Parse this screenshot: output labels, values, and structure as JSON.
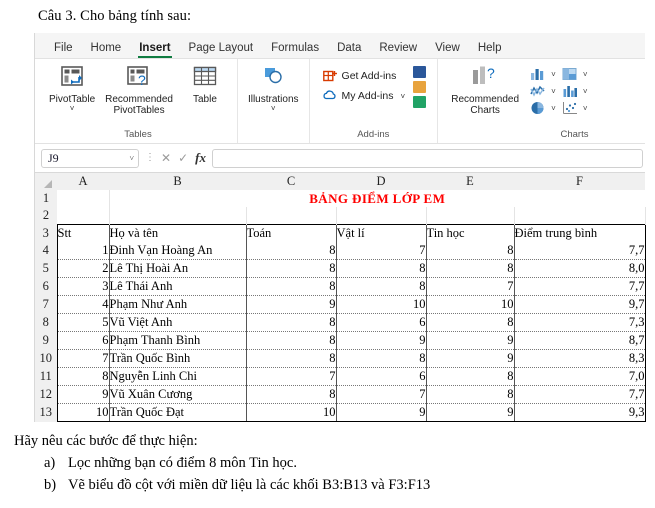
{
  "question": {
    "heading": "Câu 3. Cho bảng tính sau:"
  },
  "excel": {
    "ribbon_tabs": [
      {
        "label": "File",
        "active": false
      },
      {
        "label": "Home",
        "active": false
      },
      {
        "label": "Insert",
        "active": true
      },
      {
        "label": "Page Layout",
        "active": false
      },
      {
        "label": "Formulas",
        "active": false
      },
      {
        "label": "Data",
        "active": false
      },
      {
        "label": "Review",
        "active": false
      },
      {
        "label": "View",
        "active": false
      },
      {
        "label": "Help",
        "active": false
      }
    ],
    "groups": {
      "tables": {
        "label": "Tables",
        "buttons": [
          {
            "label": "PivotTable",
            "icon": "pivot-table-icon",
            "has_chevron": true
          },
          {
            "label": "Recommended\nPivotTables",
            "icon": "recommended-pivot-tables-icon",
            "has_chevron": false
          },
          {
            "label": "Table",
            "icon": "table-icon",
            "has_chevron": false
          }
        ]
      },
      "illustrations": {
        "label": "",
        "buttons": [
          {
            "label": "Illustrations",
            "icon": "illustrations-icon",
            "has_chevron": true
          }
        ]
      },
      "addins": {
        "label": "Add-ins",
        "buttons": [
          {
            "label": "Get Add-ins",
            "icon": "get-add-ins-icon",
            "has_chevron": false
          },
          {
            "label": "My Add-ins",
            "icon": "my-add-ins-icon",
            "has_chevron": true
          }
        ],
        "app_icons": [
          "visio-app-icon",
          "bing-maps-app-icon",
          "people-graph-app-icon"
        ]
      },
      "charts": {
        "label": "Charts",
        "recommended": {
          "label": "Recommended\nCharts",
          "icon": "recommended-charts-icon"
        },
        "mini_icons": [
          "column-chart-icon",
          "hierarchy-chart-icon",
          "line-chart-icon",
          "bar-chart-icon",
          "pie-chart-icon",
          "scatter-chart-icon"
        ]
      }
    },
    "formula_bar": {
      "name_box_value": "J9",
      "name_box_chevron": "chevron-down-icon",
      "cancel_icon": "cancel-icon",
      "enter_icon": "confirm-icon",
      "function_icon": "fx-icon",
      "formula_value": ""
    },
    "sheet": {
      "column_headers": [
        "A",
        "B",
        "C",
        "D",
        "E",
        "F"
      ],
      "row_headers": [
        "1",
        "2",
        "3",
        "4",
        "5",
        "6",
        "7",
        "8",
        "9",
        "10",
        "11",
        "12",
        "13"
      ],
      "title_row": {
        "row": "1",
        "text": "BẢNG ĐIỂM LỚP EM",
        "color": "#ff0000"
      },
      "header_row": {
        "row": "3",
        "cells": [
          "Stt",
          "Họ và tên",
          "Toán",
          "Vật lí",
          "Tin học",
          "Điểm trung bình"
        ]
      },
      "data_rows": [
        {
          "row": "4",
          "cells": [
            "1",
            "Đinh Vạn Hoàng An",
            "8",
            "7",
            "8",
            "7,7"
          ]
        },
        {
          "row": "5",
          "cells": [
            "2",
            "Lê Thị Hoài An",
            "8",
            "8",
            "8",
            "8,0"
          ]
        },
        {
          "row": "6",
          "cells": [
            "3",
            "Lê Thái Anh",
            "8",
            "8",
            "7",
            "7,7"
          ]
        },
        {
          "row": "7",
          "cells": [
            "4",
            "Phạm Như Anh",
            "9",
            "10",
            "10",
            "9,7"
          ]
        },
        {
          "row": "8",
          "cells": [
            "5",
            "Vũ Việt Anh",
            "8",
            "6",
            "8",
            "7,3"
          ]
        },
        {
          "row": "9",
          "cells": [
            "6",
            "Phạm Thanh Bình",
            "8",
            "9",
            "9",
            "8,7"
          ]
        },
        {
          "row": "10",
          "cells": [
            "7",
            "Trần Quốc Bình",
            "8",
            "8",
            "9",
            "8,3"
          ]
        },
        {
          "row": "11",
          "cells": [
            "8",
            "Nguyễn Linh Chi",
            "7",
            "6",
            "8",
            "7,0"
          ]
        },
        {
          "row": "12",
          "cells": [
            "9",
            "Vũ Xuân Cương",
            "8",
            "7",
            "8",
            "7,7"
          ]
        },
        {
          "row": "13",
          "cells": [
            "10",
            "Trần Quốc Đạt",
            "10",
            "9",
            "9",
            "9,3"
          ]
        }
      ]
    }
  },
  "footer": {
    "lead": "Hãy nêu các bước để thực hiện:",
    "items": [
      {
        "mark": "a)",
        "text": "Lọc những bạn có điểm 8 môn Tin học."
      },
      {
        "mark": "b)",
        "text": "Vẽ biểu đồ cột với miền dữ liệu là các khối B3:B13 và F3:F13"
      }
    ]
  }
}
